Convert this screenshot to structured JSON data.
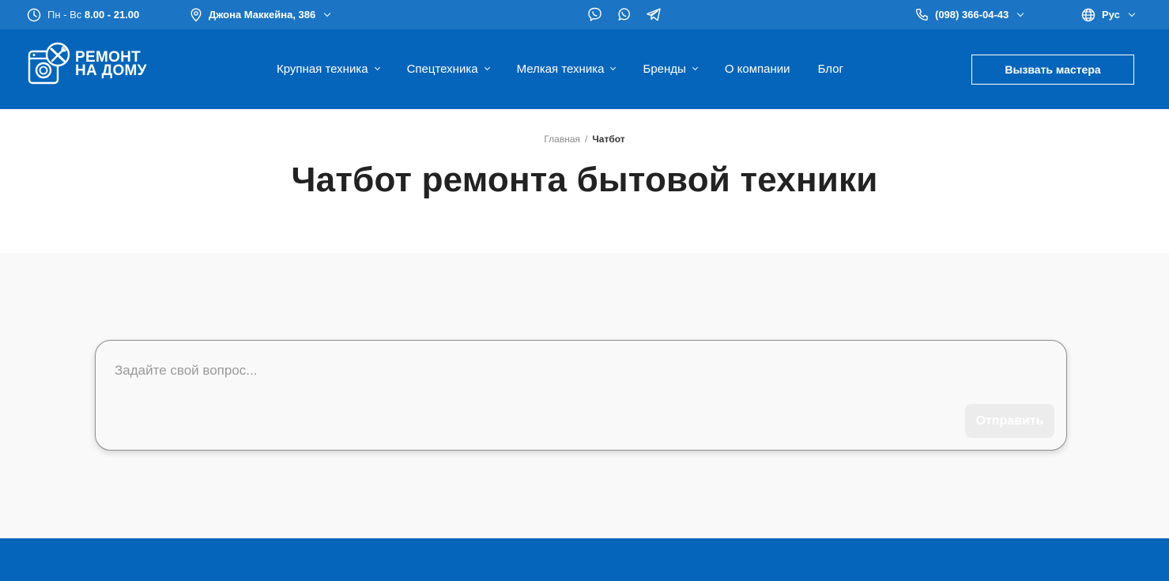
{
  "topbar": {
    "hours_prefix": "Пн - Вс",
    "hours_value": "8.00 - 21.00",
    "address": "Джона Маккейна, 386",
    "phone": "(098) 366-04-43",
    "language": "Рус"
  },
  "header": {
    "logo_line1": "РЕМОНТ",
    "logo_line2": "НА ДОМУ",
    "nav": [
      {
        "label": "Крупная техника"
      },
      {
        "label": "Спецтехника"
      },
      {
        "label": "Мелкая техника"
      },
      {
        "label": "Бренды"
      },
      {
        "label": "О компании"
      },
      {
        "label": "Блог"
      }
    ],
    "cta_label": "Вызвать мастера"
  },
  "breadcrumb": {
    "home": "Главная",
    "separator": "/",
    "current": "Чатбот"
  },
  "page_title": "Чатбот ремонта бытовой техники",
  "chat": {
    "placeholder": "Задайте свой вопрос...",
    "send_label": "Отправить"
  },
  "colors": {
    "topbar": "#1b74c4",
    "header": "#0565bb",
    "content_bg": "#f9f9f9"
  },
  "icons": [
    "clock-icon",
    "location-pin-icon",
    "viber-icon",
    "whatsapp-icon",
    "telegram-icon",
    "phone-icon",
    "globe-icon",
    "washing-machine-wrench-logo-icon"
  ]
}
